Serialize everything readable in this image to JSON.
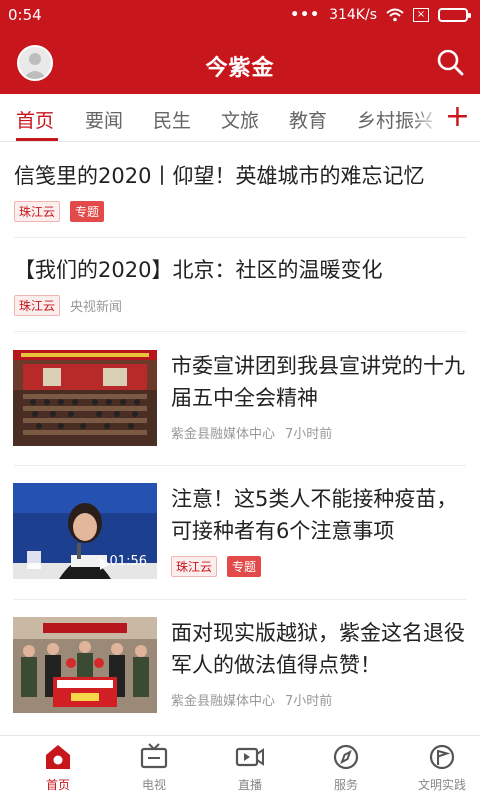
{
  "status_bar": {
    "time": "0:54",
    "dots": "•••",
    "speed": "314K/s"
  },
  "app": {
    "title": "今紫金"
  },
  "tabs": [
    {
      "label": "首页",
      "active": true
    },
    {
      "label": "要闻"
    },
    {
      "label": "民生"
    },
    {
      "label": "文旅"
    },
    {
      "label": "教育"
    },
    {
      "label": "乡村振兴"
    }
  ],
  "tabs_add_label": "+",
  "feed": [
    {
      "title": "信笺里的2020丨仰望！英雄城市的难忘记忆",
      "tags": [
        "珠江云",
        "专题"
      ]
    },
    {
      "title": "【我们的2020】北京：社区的温暖变化",
      "tag": "珠江云",
      "source": "央视新闻"
    },
    {
      "title": "市委宣讲团到我县宣讲党的十九届五中全会精神",
      "source": "紫金县融媒体中心",
      "time": "7小时前"
    },
    {
      "title": "注意！这5类人不能接种疫苗，可接种者有6个注意事项",
      "tags": [
        "珠江云",
        "专题"
      ],
      "video_duration": "01:56"
    },
    {
      "title": "面对现实版越狱，紫金这名退役军人的做法值得点赞！",
      "source": "紫金县融媒体中心",
      "time": "7小时前"
    }
  ],
  "bottom_nav": [
    {
      "label": "首页",
      "icon": "home-icon",
      "active": true
    },
    {
      "label": "电视",
      "icon": "tv-icon"
    },
    {
      "label": "直播",
      "icon": "live-icon"
    },
    {
      "label": "服务",
      "icon": "compass-icon"
    },
    {
      "label": "文明实践",
      "icon": "flag-icon"
    }
  ],
  "colors": {
    "brand": "#c8161d",
    "tag_solid": "#e34a4a",
    "muted": "#999999"
  }
}
